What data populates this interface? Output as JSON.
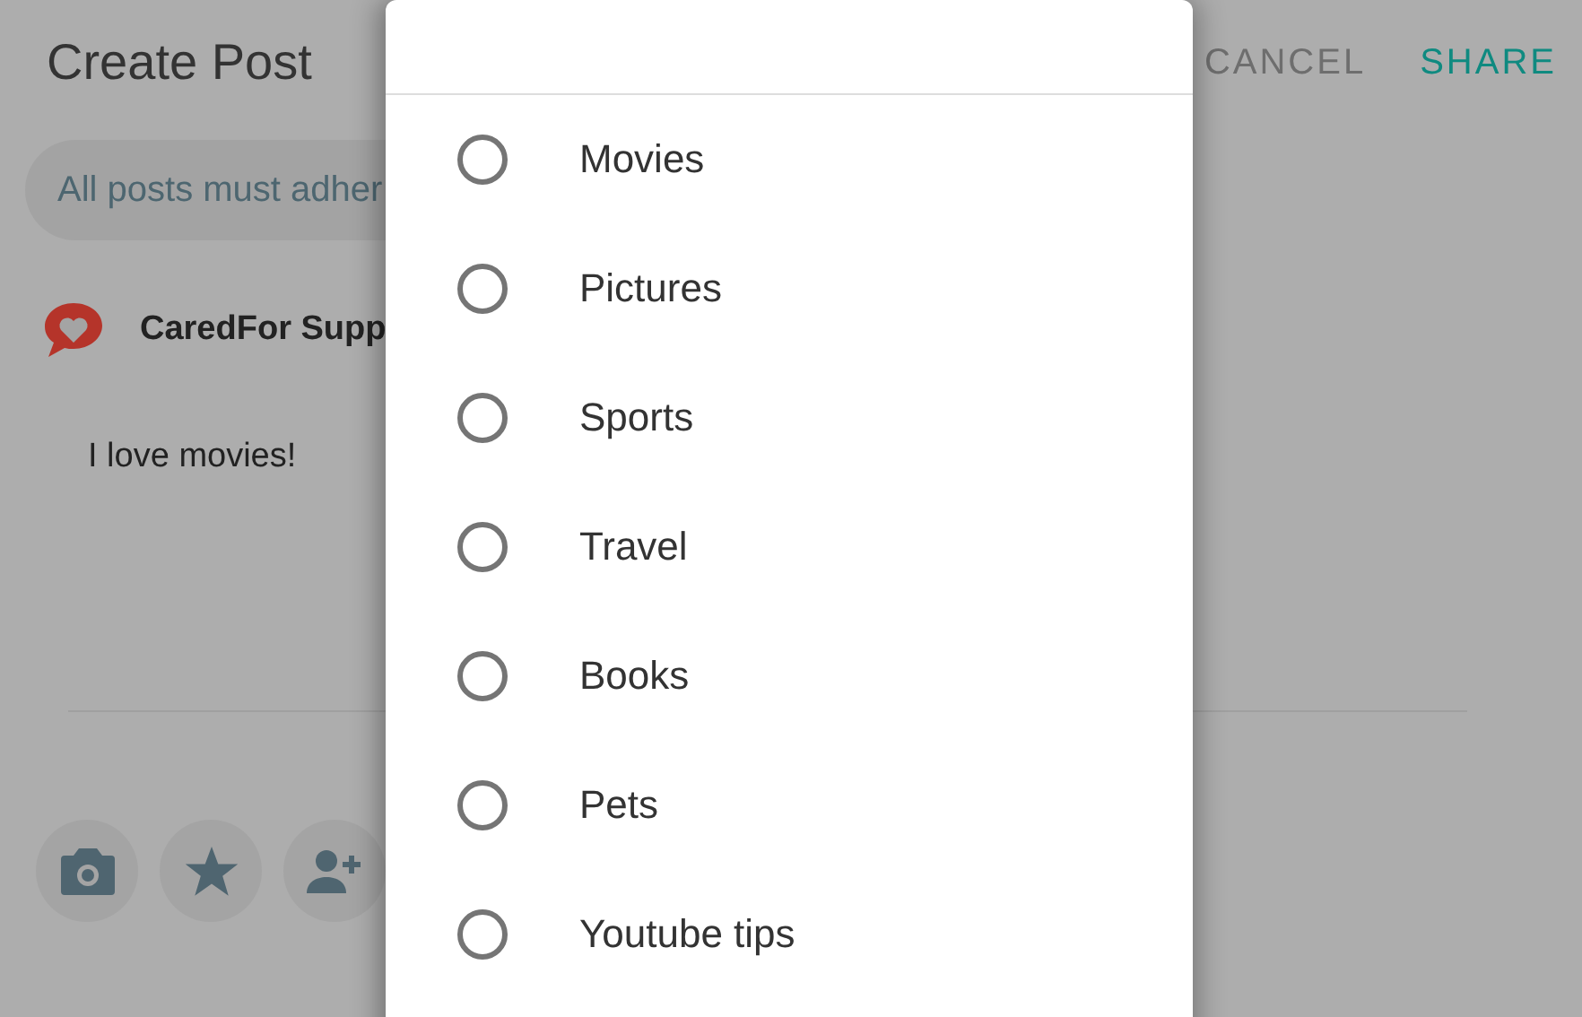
{
  "header": {
    "title": "Create Post",
    "actions": [
      {
        "label": "CANCEL",
        "kind": "cancel"
      },
      {
        "label": "SHARE",
        "kind": "primary"
      }
    ]
  },
  "notice": "All posts must adher",
  "author": "CaredFor Supp",
  "post_text": "I love movies!",
  "toolbar": [
    {
      "kind": "camera"
    },
    {
      "kind": "star"
    },
    {
      "kind": "person-add"
    }
  ],
  "dialog": {
    "options": [
      {
        "label": "Movies",
        "selected": false
      },
      {
        "label": "Pictures",
        "selected": false
      },
      {
        "label": "Sports",
        "selected": false
      },
      {
        "label": "Travel",
        "selected": false
      },
      {
        "label": "Books",
        "selected": false
      },
      {
        "label": "Pets",
        "selected": false
      },
      {
        "label": "Youtube tips",
        "selected": false
      }
    ]
  }
}
